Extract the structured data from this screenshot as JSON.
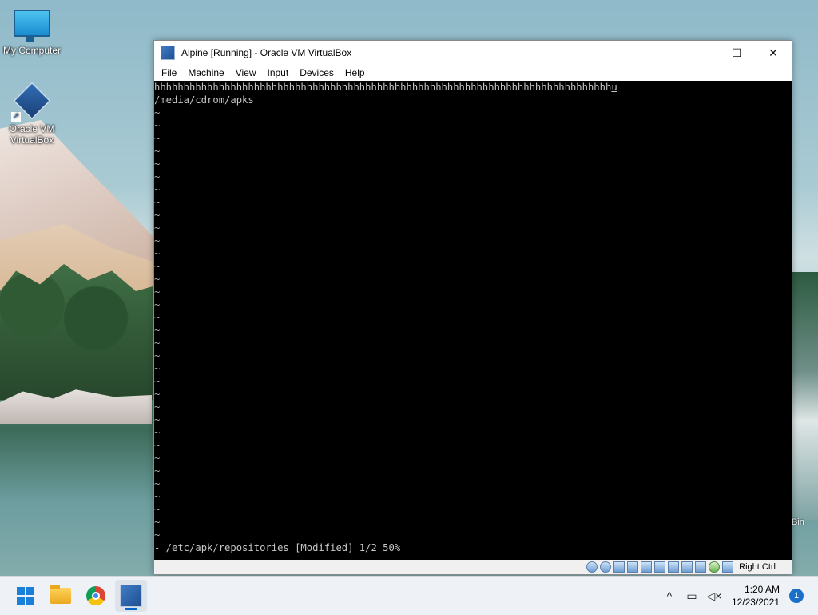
{
  "desktop": {
    "icons": [
      {
        "label": "My Computer"
      },
      {
        "label_line1": "Oracle VM",
        "label_line2": "VirtualBox"
      }
    ],
    "recycle_bin_fragment": "Bin"
  },
  "window": {
    "title": "Alpine [Running] - Oracle VM VirtualBox",
    "controls": {
      "minimize": "—",
      "maximize": "☐",
      "close": "✕"
    },
    "menu": [
      "File",
      "Machine",
      "View",
      "Input",
      "Devices",
      "Help"
    ]
  },
  "console": {
    "line1_text": "hhhhhhhhhhhhhhhhhhhhhhhhhhhhhhhhhhhhhhhhhhhhhhhhhhhhhhhhhhhhhhhhhhhhhhhhhhhhhh",
    "line1_cursor": "u",
    "line2": "/media/cdrom/apks",
    "tilde": "~",
    "status": "- /etc/apk/repositories [Modified] 1/2 50%"
  },
  "vm_status": {
    "host_key": "Right Ctrl"
  },
  "taskbar": {
    "time": "1:20 AM",
    "date": "12/23/2021",
    "notifications": "1"
  }
}
